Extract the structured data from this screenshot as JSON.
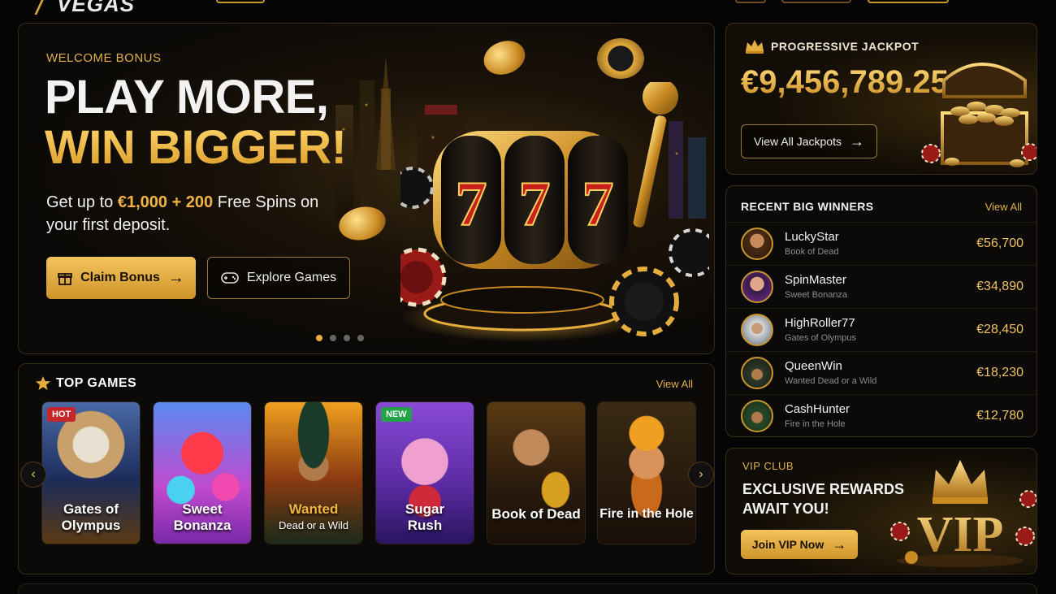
{
  "brand": {
    "name": "VEGAS"
  },
  "hero": {
    "kicker": "WELCOME BONUS",
    "headline_1": "PLAY MORE,",
    "headline_2": "WIN BIGGER!",
    "sub_pre": "Get up to ",
    "sub_amount": "€1,000 + 200",
    "sub_post": " Free Spins on your first deposit.",
    "claim_label": "Claim Bonus",
    "explore_label": "Explore Games",
    "slides": 4,
    "active_slide": 1,
    "reel_symbols": [
      "7",
      "7",
      "7"
    ]
  },
  "jackpot": {
    "title": "PROGRESSIVE JACKPOT",
    "amount": "€9,456,789.25",
    "button": "View All Jackpots"
  },
  "winners": {
    "title": "RECENT BIG WINNERS",
    "view_all": "View All",
    "items": [
      {
        "name": "LuckyStar",
        "game": "Book of Dead",
        "amount": "€56,700"
      },
      {
        "name": "SpinMaster",
        "game": "Sweet Bonanza",
        "amount": "€34,890"
      },
      {
        "name": "HighRoller77",
        "game": "Gates of Olympus",
        "amount": "€28,450"
      },
      {
        "name": "QueenWin",
        "game": "Wanted Dead or a Wild",
        "amount": "€18,230"
      },
      {
        "name": "CashHunter",
        "game": "Fire in the Hole",
        "amount": "€12,780"
      }
    ]
  },
  "vip": {
    "kicker": "VIP CLUB",
    "headline": "EXCLUSIVE REWARDS AWAIT YOU!",
    "button": "Join VIP Now",
    "art_text": "VIP"
  },
  "games": {
    "title": "TOP GAMES",
    "view_all": "View All",
    "items": [
      {
        "title": "Gates of Olympus",
        "sub": "",
        "badge": "HOT"
      },
      {
        "title": "Sweet Bonanza",
        "sub": "",
        "badge": ""
      },
      {
        "title": "Wanted",
        "sub": "Dead or a Wild",
        "badge": ""
      },
      {
        "title": "Sugar Rush",
        "sub": "",
        "badge": "NEW"
      },
      {
        "title": "Book of Dead",
        "sub": "",
        "badge": ""
      },
      {
        "title": "Fire in the Hole",
        "sub": "",
        "badge": ""
      }
    ]
  },
  "colors": {
    "gold": "#f2b541",
    "background": "#050505",
    "border": "#3a2c14",
    "hot": "#c4262a",
    "new": "#23a24a"
  }
}
